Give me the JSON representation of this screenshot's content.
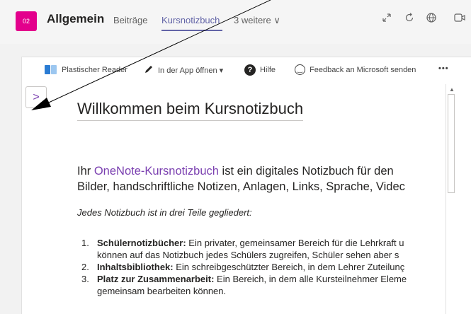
{
  "header": {
    "team_badge": "02",
    "channel": "Allgemein",
    "tabs": [
      {
        "label": "Beiträge",
        "active": false
      },
      {
        "label": "Kursnotizbuch",
        "active": true
      },
      {
        "label": "3 weitere ∨",
        "active": false
      }
    ],
    "icons": [
      "expand-icon",
      "refresh-icon",
      "globe-icon",
      "meet-icon"
    ],
    "accent": "#6264a7",
    "badge_color": "#e3008c"
  },
  "toolbar": {
    "items": [
      {
        "label": "Plastischer Reader",
        "icon": "immersive-reader-icon"
      },
      {
        "label": "In der App öffnen ▾",
        "icon": "pencil-icon"
      },
      {
        "label": "Hilfe",
        "icon": "help-icon"
      },
      {
        "label": "Feedback an Microsoft senden",
        "icon": "smiley-icon"
      }
    ],
    "more": "•••"
  },
  "nav_toggle": {
    "glyph": ">",
    "icon": "chevron-right-icon"
  },
  "page": {
    "title": "Willkommen beim Kursnotizbuch",
    "intro_prefix": "Ihr ",
    "intro_link": "OneNote-Kursnotizbuch",
    "intro_rest": " ist ein digitales Notizbuch für den",
    "intro_line2": "Bilder, handschriftliche Notizen, Anlagen, Links, Sprache, Videc",
    "italic": "Jedes Notizbuch ist in drei Teile gegliedert:",
    "list": [
      {
        "num": "1.",
        "term": "Schülernotizbücher:",
        "text": " Ein privater, gemeinsamer Bereich für die Lehrkraft u",
        "cont": "können auf das Notizbuch jedes Schülers zugreifen, Schüler sehen aber s"
      },
      {
        "num": "2.",
        "term": "Inhaltsbibliothek:",
        "text": " Ein schreibgeschützter Bereich, in dem Lehrer Zuteilunç",
        "cont": ""
      },
      {
        "num": "3.",
        "term": "Platz zur Zusammenarbeit:",
        "text": " Ein Bereich, in dem alle Kursteilnehmer Eleme",
        "cont": "gemeinsam bearbeiten können."
      }
    ],
    "link_color": "#7a3fb0"
  }
}
